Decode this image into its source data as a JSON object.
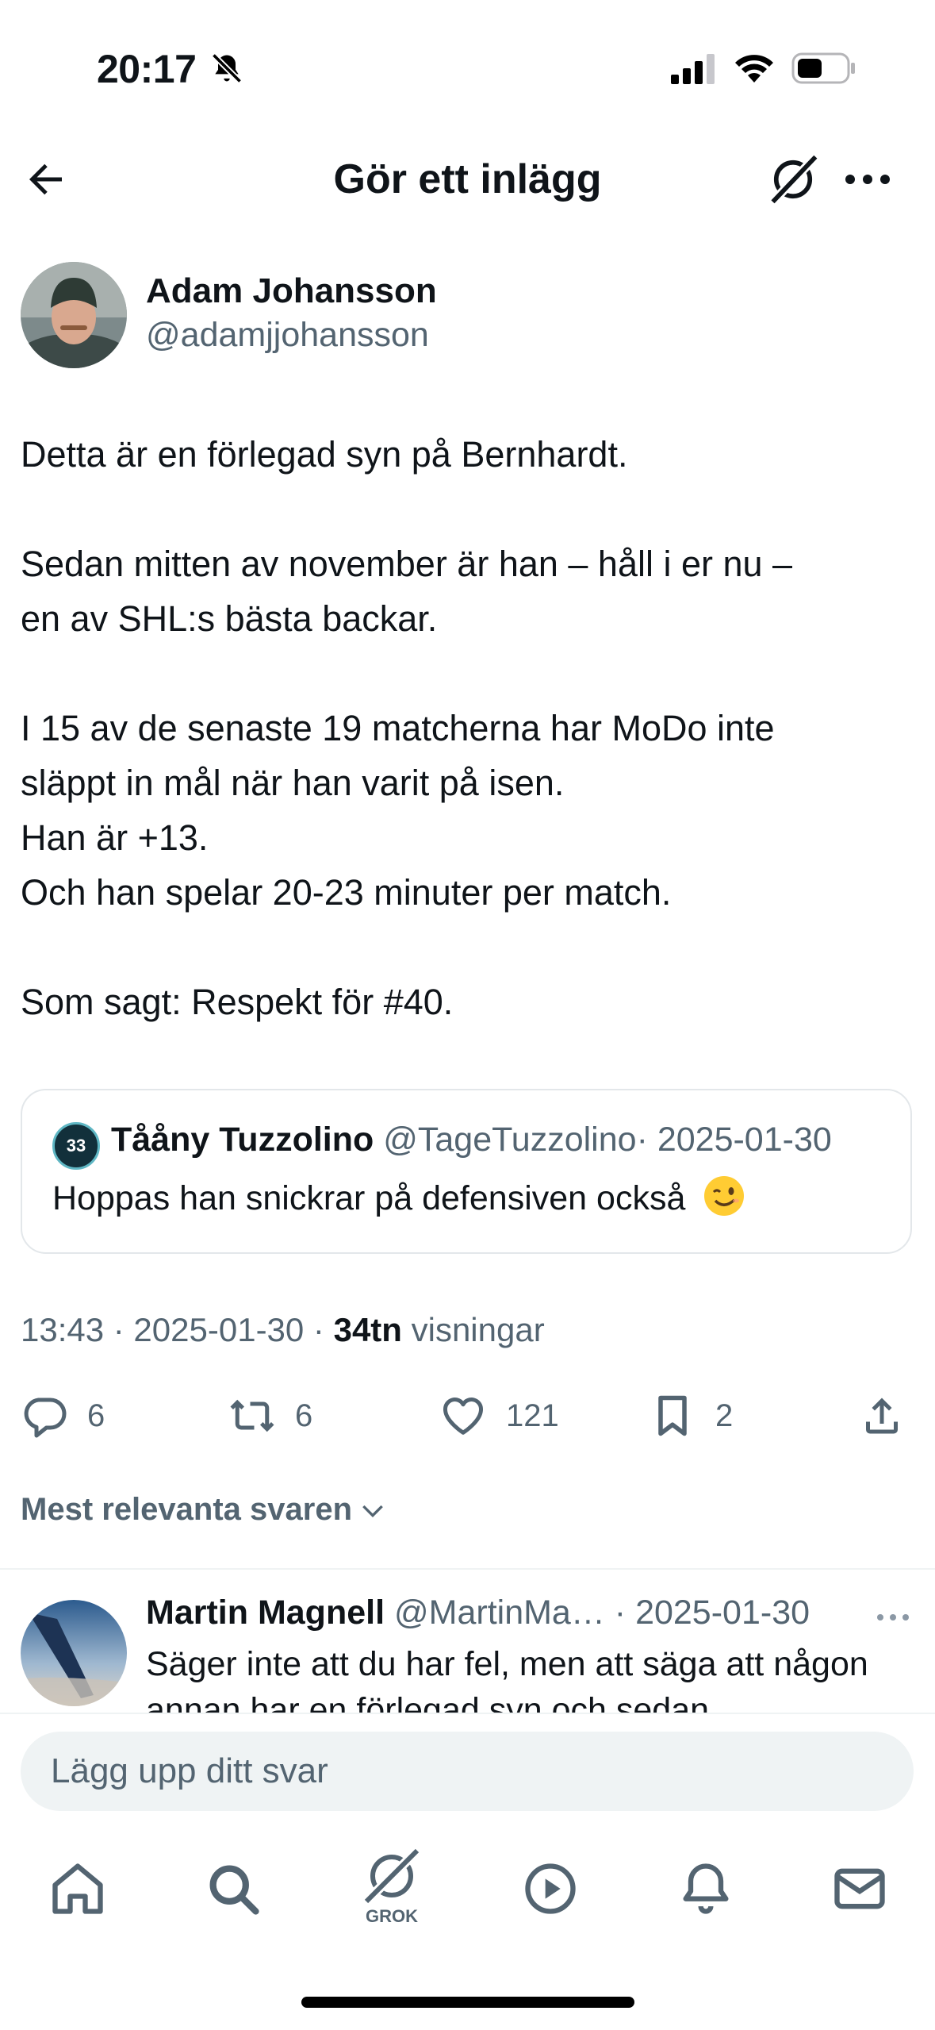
{
  "status_bar": {
    "time": "20:17"
  },
  "header": {
    "title": "Gör ett inlägg"
  },
  "post": {
    "author_name": "Adam Johansson",
    "author_handle": "@adamjjohansson",
    "body": {
      "line1": "Detta är en förlegad syn på Bernhardt.",
      "line2": "Sedan mitten av november är han – håll i er nu –",
      "line3": "en av SHL:s bästa backar.",
      "line4": "I 15 av de senaste 19 matcherna har MoDo inte",
      "line5": "släppt in mål när han varit på isen.",
      "line6": "Han är +13.",
      "line7": "Och han spelar 20-23 minuter per match.",
      "line8": "Som sagt: Respekt för #40."
    },
    "quote": {
      "avatar_text": "33",
      "name": "Tååny Tuzzolino",
      "handle": "@TageTuzzolino",
      "date": "· 2025-01-30",
      "text": "Hoppas han snickrar på defensiven också",
      "emoji": "winking-face"
    },
    "meta": {
      "time_date": "13:43 · 2025-01-30 · ",
      "views_count": "34tn",
      "views_label": " visningar"
    },
    "actions": {
      "replies": "6",
      "reposts": "6",
      "likes": "121",
      "bookmarks": "2"
    }
  },
  "replies_sort_label": "Mest relevanta svaren",
  "reply": {
    "name": "Martin Magnell",
    "handle": "@MartinMa…",
    "date": "· 2025-01-30",
    "text": "Säger inte att du har fel, men att säga att någon annan har en förlegad syn och sedan"
  },
  "composer": {
    "placeholder": "Lägg upp ditt svar"
  },
  "bottom_nav": {
    "grok_label": "GROK"
  },
  "colors": {
    "text": "#0f1419",
    "secondary": "#536471",
    "divider": "#eff3f4"
  }
}
